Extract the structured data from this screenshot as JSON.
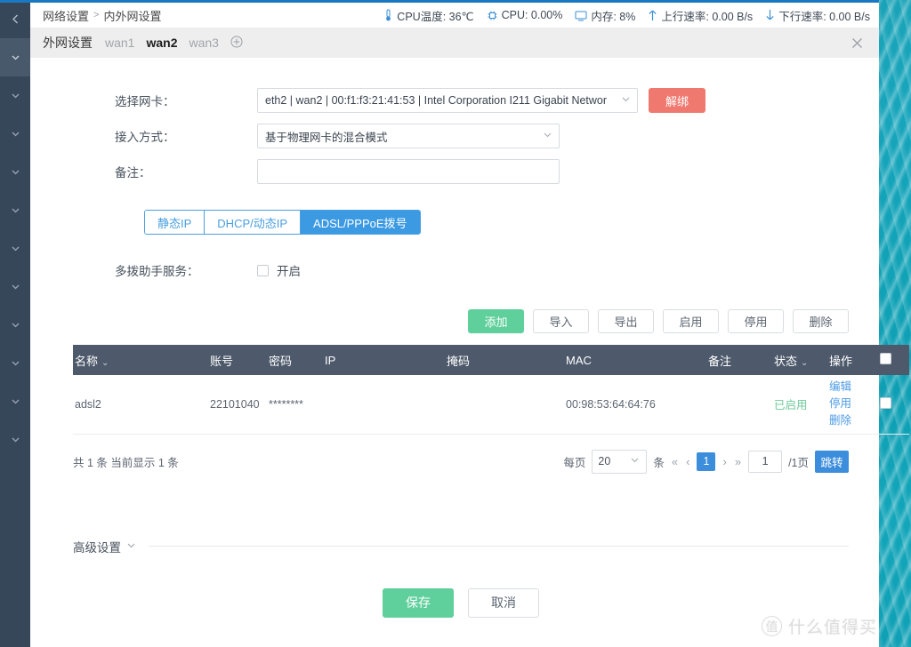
{
  "theme": {
    "accent_blue": "#3c8ddc",
    "sidebar_bg": "#37475a",
    "table_header_bg": "#4e5a6b",
    "primary_green": "#5fcf9b",
    "danger_red": "#f0796f",
    "status_green": "#6fc99a",
    "link_blue": "#4b9ae6",
    "water_teal": "#10a2b6"
  },
  "sidebar": {
    "collapse_icon": "chevron-left-icon",
    "items": [
      {
        "icon": "chevron-left-icon",
        "state": "collapse"
      },
      {
        "icon": "chevron-down-icon",
        "state": "active"
      },
      {
        "icon": "chevron-down-icon",
        "state": "normal"
      },
      {
        "icon": "chevron-down-icon",
        "state": "normal"
      },
      {
        "icon": "chevron-down-icon",
        "state": "normal"
      },
      {
        "icon": "chevron-down-icon",
        "state": "normal"
      },
      {
        "icon": "chevron-down-icon",
        "state": "normal"
      },
      {
        "icon": "chevron-down-icon",
        "state": "normal"
      },
      {
        "icon": "chevron-down-icon",
        "state": "normal"
      },
      {
        "icon": "chevron-down-icon",
        "state": "normal"
      },
      {
        "icon": "chevron-down-icon",
        "state": "normal"
      },
      {
        "icon": "chevron-down-icon",
        "state": "normal"
      }
    ]
  },
  "breadcrumb": {
    "root": "网络设置",
    "separator": ">",
    "current": "内外网设置"
  },
  "status_bar": {
    "cpu_temp": {
      "icon": "thermometer-icon",
      "label": "CPU温度: 36℃"
    },
    "cpu_usage": {
      "icon": "cpu-chip-icon",
      "label": "CPU: 0.00%"
    },
    "memory": {
      "icon": "monitor-icon",
      "label": "内存: 8%"
    },
    "upload": {
      "icon": "arrow-up-icon",
      "label": "上行速率: 0.00 B/s"
    },
    "download": {
      "icon": "arrow-down-icon",
      "label": "下行速率: 0.00 B/s"
    }
  },
  "panel": {
    "title": "外网设置",
    "tabs": [
      {
        "label": "wan1",
        "active": false
      },
      {
        "label": "wan2",
        "active": true
      },
      {
        "label": "wan3",
        "active": false
      }
    ],
    "add_tab_icon": "plus-circle-icon",
    "close_icon": "close-icon"
  },
  "form": {
    "nic": {
      "label": "选择网卡：",
      "value": "eth2 | wan2 | 00:f1:f3:21:41:53 | Intel Corporation I211 Gigabit Networ",
      "unbind_button": "解绑"
    },
    "mode": {
      "label": "接入方式：",
      "value": "基于物理网卡的混合模式"
    },
    "remark": {
      "label": "备注：",
      "value": "",
      "placeholder": ""
    }
  },
  "mode_tabs": [
    {
      "label": "静态IP",
      "active": false
    },
    {
      "label": "DHCP/动态IP",
      "active": false
    },
    {
      "label": "ADSL/PPPoE拨号",
      "active": true
    }
  ],
  "multidial": {
    "label": "多拨助手服务：",
    "checkbox_label": "开启",
    "checked": false
  },
  "action_buttons": [
    {
      "label": "添加",
      "primary": true
    },
    {
      "label": "导入",
      "primary": false
    },
    {
      "label": "导出",
      "primary": false
    },
    {
      "label": "启用",
      "primary": false
    },
    {
      "label": "停用",
      "primary": false
    },
    {
      "label": "删除",
      "primary": false
    }
  ],
  "table": {
    "columns": [
      {
        "label": "名称",
        "sortable": true
      },
      {
        "label": "账号",
        "sortable": false
      },
      {
        "label": "密码",
        "sortable": false
      },
      {
        "label": "IP",
        "sortable": false
      },
      {
        "label": "掩码",
        "sortable": false
      },
      {
        "label": "MAC",
        "sortable": false
      },
      {
        "label": "备注",
        "sortable": false
      },
      {
        "label": "状态",
        "sortable": true
      },
      {
        "label": "操作",
        "sortable": false
      },
      {
        "label": "",
        "sortable": false
      }
    ],
    "sort_caret": "⌄",
    "rows": [
      {
        "name": "adsl2",
        "account": "22101040",
        "password": "********",
        "ip": "",
        "mask": "",
        "mac": "00:98:53:64:64:76",
        "remark": "",
        "status": "已启用",
        "ops": [
          "编辑",
          "停用",
          "删除"
        ],
        "checked": false
      }
    ]
  },
  "pagination": {
    "summary": "共 1 条 当前显示 1 条",
    "per_page_prefix": "每页",
    "per_page_value": "20",
    "per_page_suffix": "条",
    "first_icon": "«",
    "prev_icon": "‹",
    "current_page": "1",
    "next_icon": "›",
    "last_icon": "»",
    "jump_value": "1",
    "total_pages_label": "/1页",
    "jump_button": "跳转"
  },
  "advanced": {
    "label": "高级设置",
    "caret_icon": "chevron-down-icon"
  },
  "footer": {
    "save": "保存",
    "cancel": "取消"
  },
  "watermark": {
    "mark": "值",
    "text": "什么值得买"
  }
}
